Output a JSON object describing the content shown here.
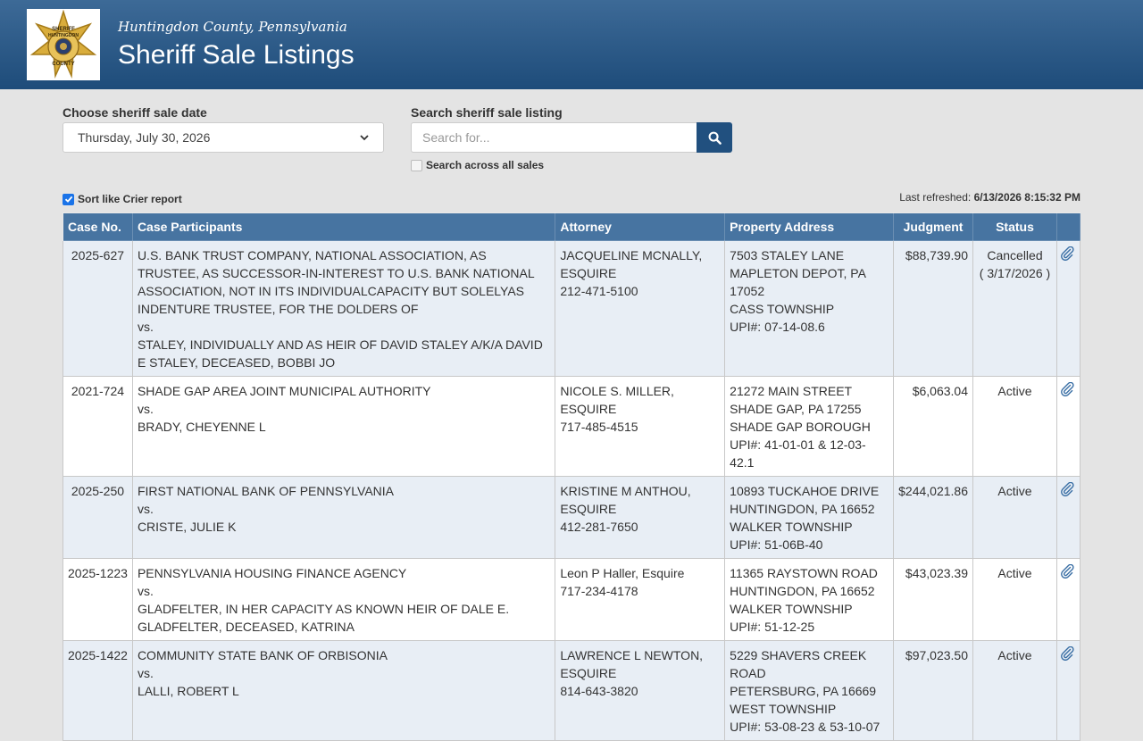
{
  "header": {
    "county": "Huntingdon County, Pennsylvania",
    "title": "Sheriff Sale Listings",
    "logo_text_top": "SHERIFF",
    "logo_text_mid": "HUNTINGDON",
    "logo_text_bottom": "COUNTY"
  },
  "controls": {
    "date_label": "Choose sheriff sale date",
    "date_value": "Thursday, July 30, 2026",
    "search_label": "Search sheriff sale listing",
    "search_placeholder": "Search for...",
    "search_all_label": "Search across all sales",
    "search_all_checked": false,
    "sort_label": "Sort like Crier report",
    "sort_checked": true,
    "refreshed_label": "Last refreshed:",
    "refreshed_value": "6/13/2026 8:15:32 PM"
  },
  "table": {
    "headers": [
      "Case No.",
      "Case Participants",
      "Attorney",
      "Property Address",
      "Judgment",
      "Status",
      ""
    ],
    "rows": [
      {
        "case_no": "2025-627",
        "participants": [
          "U.S. BANK TRUST COMPANY, NATIONAL ASSOCIATION, AS TRUSTEE, AS SUCCESSOR-IN-INTEREST TO U.S. BANK NATIONAL ASSOCIATION, NOT IN ITS INDIVIDUALCAPACITY BUT SOLELYAS INDENTURE TRUSTEE, FOR THE DOLDERS OF",
          "vs.",
          "STALEY, INDIVIDUALLY AND AS HEIR OF DAVID STALEY A/K/A DAVID E STALEY, DECEASED, BOBBI JO"
        ],
        "attorney": [
          "JACQUELINE MCNALLY, ESQUIRE",
          "212-471-5100"
        ],
        "address": [
          "7503 STALEY LANE",
          "MAPLETON DEPOT, PA 17052",
          "CASS TOWNSHIP",
          "UPI#: 07-14-08.6"
        ],
        "judgment": "$88,739.90",
        "status": [
          "Cancelled",
          "( 3/17/2026 )"
        ]
      },
      {
        "case_no": "2021-724",
        "participants": [
          "SHADE GAP AREA JOINT MUNICIPAL AUTHORITY",
          "vs.",
          "BRADY, CHEYENNE L"
        ],
        "attorney": [
          "NICOLE S. MILLER, ESQUIRE",
          "717-485-4515"
        ],
        "address": [
          "21272 MAIN STREET",
          "SHADE GAP, PA 17255",
          "SHADE GAP BOROUGH",
          "UPI#: 41-01-01 & 12-03-42.1"
        ],
        "judgment": "$6,063.04",
        "status": [
          "Active"
        ]
      },
      {
        "case_no": "2025-250",
        "participants": [
          "FIRST NATIONAL BANK OF PENNSYLVANIA",
          "vs.",
          "CRISTE, JULIE K"
        ],
        "attorney": [
          "KRISTINE M ANTHOU, ESQUIRE",
          "412-281-7650"
        ],
        "address": [
          "10893 TUCKAHOE DRIVE",
          "HUNTINGDON, PA 16652",
          "WALKER TOWNSHIP",
          "UPI#: 51-06B-40"
        ],
        "judgment": "$244,021.86",
        "status": [
          "Active"
        ]
      },
      {
        "case_no": "2025-1223",
        "participants": [
          "PENNSYLVANIA HOUSING FINANCE AGENCY",
          "vs.",
          "GLADFELTER, IN HER CAPACITY AS KNOWN HEIR OF DALE E. GLADFELTER, DECEASED, KATRINA"
        ],
        "attorney": [
          "Leon P Haller, Esquire",
          "717-234-4178"
        ],
        "address": [
          "11365 RAYSTOWN ROAD",
          "HUNTINGDON, PA 16652",
          "WALKER TOWNSHIP",
          "UPI#: 51-12-25"
        ],
        "judgment": "$43,023.39",
        "status": [
          "Active"
        ]
      },
      {
        "case_no": "2025-1422",
        "participants": [
          "COMMUNITY STATE BANK OF ORBISONIA",
          "vs.",
          "LALLI, ROBERT L"
        ],
        "attorney": [
          "LAWRENCE L NEWTON, ESQUIRE",
          "814-643-3820"
        ],
        "address": [
          "5229 SHAVERS CREEK ROAD",
          "PETERSBURG, PA 16669",
          "WEST TOWNSHIP",
          "UPI#: 53-08-23 & 53-10-07"
        ],
        "judgment": "$97,023.50",
        "status": [
          "Active"
        ]
      }
    ]
  },
  "colors": {
    "header_top": "#3d6a97",
    "header_bottom": "#1e4c7a",
    "table_header": "#4774a1",
    "search_button": "#21507f",
    "row_alt": "#e8eef5"
  },
  "icons": {
    "search": "search-icon",
    "attachment": "paperclip-icon",
    "dropdown": "chevron-down-icon",
    "logo": "sheriff-star-badge"
  }
}
